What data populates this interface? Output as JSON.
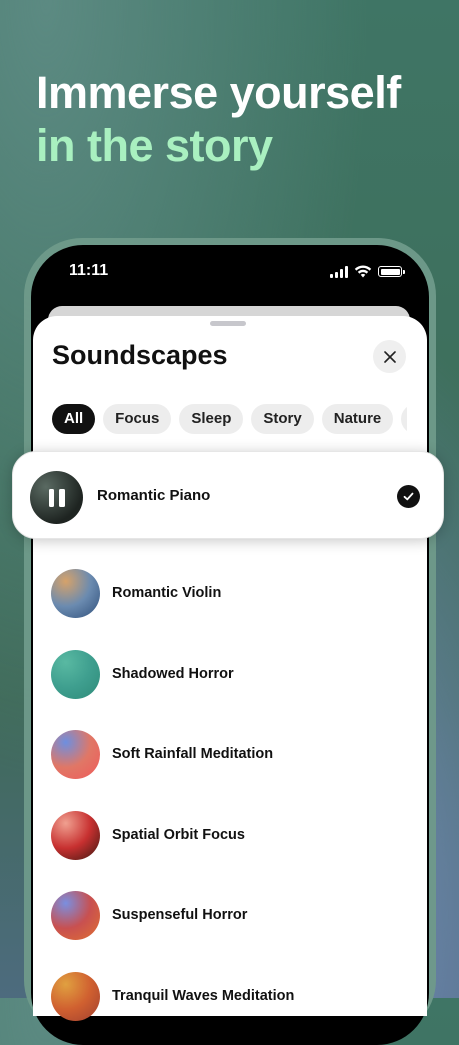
{
  "headline": {
    "line1": "Immerse yourself",
    "line2": "in the story"
  },
  "status_bar": {
    "time": "11:11"
  },
  "sheet": {
    "title": "Soundscapes"
  },
  "chips": [
    {
      "label": "All",
      "active": true
    },
    {
      "label": "Focus",
      "active": false
    },
    {
      "label": "Sleep",
      "active": false
    },
    {
      "label": "Story",
      "active": false
    },
    {
      "label": "Nature",
      "active": false
    },
    {
      "label": "",
      "active": false
    }
  ],
  "now_playing": {
    "label": "Romantic Piano",
    "state_icon": "pause-icon",
    "selected_icon": "check-icon"
  },
  "items": [
    {
      "label": "Romantic Violin",
      "colors": [
        "#d6a26a",
        "#6b8bb0",
        "#2f4f7a"
      ]
    },
    {
      "label": "Shadowed Horror",
      "colors": [
        "#59b9a2",
        "#3f9f8f",
        "#2e8b79"
      ]
    },
    {
      "label": "Soft Rainfall Meditation",
      "colors": [
        "#6d8fe0",
        "#e07766",
        "#f05a5a"
      ]
    },
    {
      "label": "Spatial Orbit Focus",
      "colors": [
        "#f0a090",
        "#c73030",
        "#3a1810"
      ]
    },
    {
      "label": "Suspenseful Horror",
      "colors": [
        "#7a8fe0",
        "#c85050",
        "#e07030"
      ]
    },
    {
      "label": "Tranquil Waves Meditation",
      "colors": [
        "#e0a040",
        "#d06030",
        "#a04030"
      ]
    }
  ]
}
